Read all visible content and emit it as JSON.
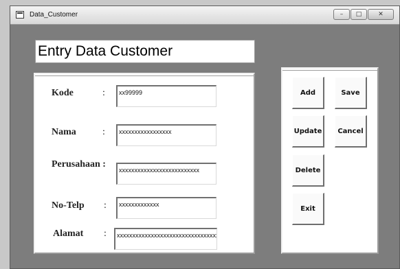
{
  "window": {
    "title": "Data_Customer",
    "controls": {
      "minimize": "–",
      "maximize": "□",
      "close": "✕"
    }
  },
  "header": {
    "title": "Entry Data Customer"
  },
  "form": {
    "colon": ":",
    "fields": [
      {
        "label": "Kode",
        "value": "xx99999"
      },
      {
        "label": "Nama",
        "value": "xxxxxxxxxxxxxxxxx"
      },
      {
        "label": "Perusahaan :",
        "value": "xxxxxxxxxxxxxxxxxxxxxxxxxx"
      },
      {
        "label": "No-Telp",
        "value": "xxxxxxxxxxxxx"
      },
      {
        "label": "Alamat",
        "value": "xxxxxxxxxxxxxxxxxxxxxxxxxxxxxxxxxx"
      }
    ]
  },
  "buttons": {
    "add": "Add",
    "save": "Save",
    "update": "Update",
    "cancel": "Cancel",
    "delete": "Delete",
    "exit": "Exit"
  }
}
